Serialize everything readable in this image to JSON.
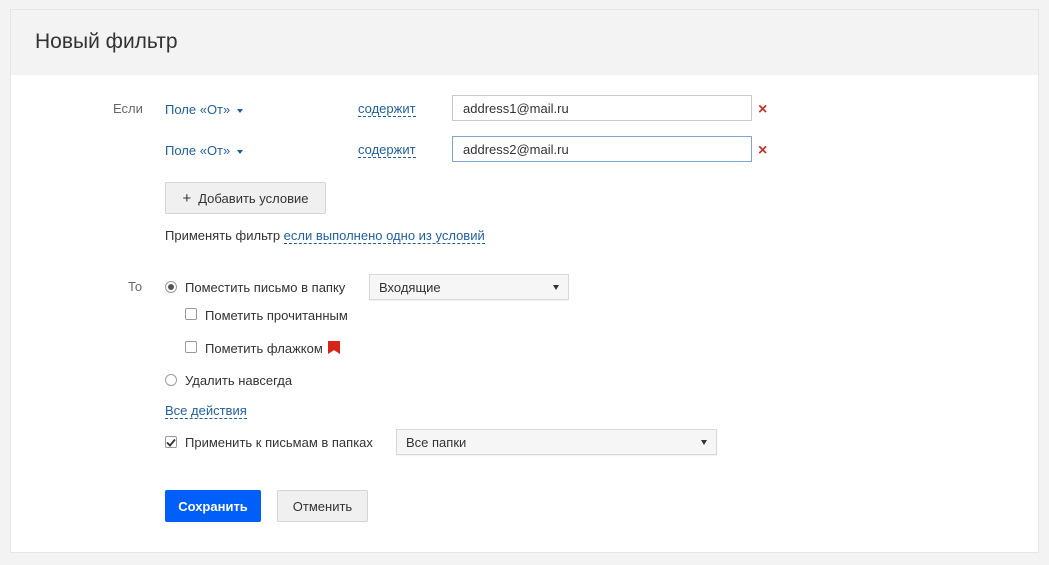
{
  "header": {
    "title": "Новый фильтр"
  },
  "conditions": {
    "if_label": "Если",
    "rows": [
      {
        "field": "Поле «От»",
        "operator": "содержит",
        "value": "address1@mail.ru"
      },
      {
        "field": "Поле «От»",
        "operator": "содержит",
        "value": "address2@mail.ru"
      }
    ],
    "add_plus": "+",
    "add_label": "Добавить условие",
    "apply_prefix": "Применять фильтр",
    "apply_mode": "если выполнено одно из условий"
  },
  "actions": {
    "then_label": "То",
    "move_label": "Поместить письмо в папку",
    "folder_selected": "Входящие",
    "mark_read_label": "Пометить прочитанным",
    "mark_flag_label": "Пометить флажком",
    "delete_label": "Удалить навсегда",
    "all_actions_link": "Все действия",
    "apply_folders_label": "Применить к письмам в папках",
    "folders_selected": "Все папки"
  },
  "footer": {
    "save_label": "Сохранить",
    "cancel_label": "Отменить"
  },
  "colors": {
    "accent": "#005ff9",
    "link": "#1f5f9f",
    "remove": "#c0352b",
    "flag": "#d9241a"
  }
}
